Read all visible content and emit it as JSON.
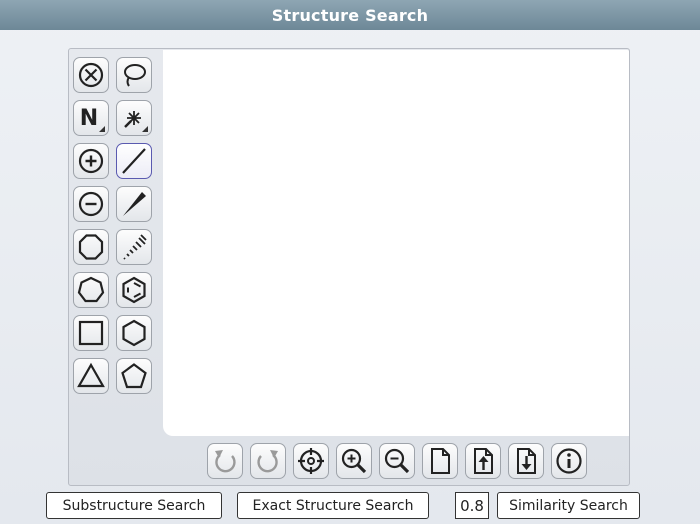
{
  "window": {
    "title": "Structure Search"
  },
  "tools": [
    {
      "name": "clear-tool",
      "icon": "erase-circle-icon"
    },
    {
      "name": "lasso-tool",
      "icon": "lasso-icon"
    },
    {
      "name": "atom-tool",
      "icon": "atom-n-icon",
      "label": "N"
    },
    {
      "name": "charge-tool",
      "icon": "spark-icon"
    },
    {
      "name": "charge-plus-tool",
      "icon": "plus-circle-icon"
    },
    {
      "name": "single-bond-tool",
      "icon": "single-bond-icon",
      "active": true
    },
    {
      "name": "charge-minus-tool",
      "icon": "minus-circle-icon"
    },
    {
      "name": "wedge-bond-tool",
      "icon": "wedge-bond-icon"
    },
    {
      "name": "octagon-tool",
      "icon": "octagon-icon"
    },
    {
      "name": "hash-bond-tool",
      "icon": "hashed-bond-icon"
    },
    {
      "name": "heptagon-tool",
      "icon": "heptagon-icon"
    },
    {
      "name": "benzene-tool",
      "icon": "benzene-icon"
    },
    {
      "name": "square-tool",
      "icon": "square-icon"
    },
    {
      "name": "hexagon-tool",
      "icon": "hexagon-icon"
    },
    {
      "name": "triangle-tool",
      "icon": "triangle-icon"
    },
    {
      "name": "pentagon-tool",
      "icon": "pentagon-icon"
    }
  ],
  "bottom_toolbar": [
    {
      "name": "undo-button",
      "icon": "undo-icon"
    },
    {
      "name": "redo-button",
      "icon": "redo-icon"
    },
    {
      "name": "center-button",
      "icon": "crosshair-icon"
    },
    {
      "name": "zoom-in-button",
      "icon": "zoom-in-icon"
    },
    {
      "name": "zoom-out-button",
      "icon": "zoom-out-icon"
    },
    {
      "name": "new-button",
      "icon": "new-document-icon"
    },
    {
      "name": "import-button",
      "icon": "upload-document-icon"
    },
    {
      "name": "export-button",
      "icon": "download-document-icon"
    },
    {
      "name": "info-button",
      "icon": "info-icon"
    }
  ],
  "actions": {
    "substructure_label": "Substructure Search",
    "exact_label": "Exact Structure Search",
    "similarity_threshold": "0.8",
    "similarity_label": "Similarity Search"
  }
}
